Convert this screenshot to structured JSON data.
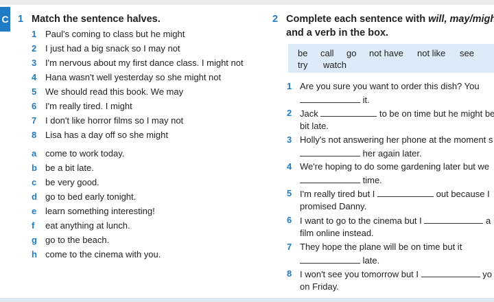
{
  "tab": {
    "label": "C"
  },
  "ex1": {
    "number": "1",
    "title": "Match the sentence halves.",
    "items": [
      {
        "num": "1",
        "text": "Paul's coming to class but he might"
      },
      {
        "num": "2",
        "text": "I just had a big snack so I may not"
      },
      {
        "num": "3",
        "text": "I'm nervous about my first dance class. I might not"
      },
      {
        "num": "4",
        "text": "Hana wasn't well yesterday so she might not"
      },
      {
        "num": "5",
        "text": "We should read this book. We may"
      },
      {
        "num": "6",
        "text": "I'm really tired. I might"
      },
      {
        "num": "7",
        "text": "I don't like horror films so I may not"
      },
      {
        "num": "8",
        "text": "Lisa has a day off so she might"
      }
    ],
    "endings": [
      {
        "letter": "a",
        "text": "come to work today."
      },
      {
        "letter": "b",
        "text": "be a bit late."
      },
      {
        "letter": "c",
        "text": "be very good."
      },
      {
        "letter": "d",
        "text": "go to bed early tonight."
      },
      {
        "letter": "e",
        "text": "learn something interesting!"
      },
      {
        "letter": "f",
        "text": "eat anything at lunch."
      },
      {
        "letter": "g",
        "text": "go to the beach."
      },
      {
        "letter": "h",
        "text": "come to the cinema with you."
      }
    ]
  },
  "ex2": {
    "number": "2",
    "title_pre": "Complete each sentence with ",
    "title_italic": "will, may/might",
    "title_line2": "and a verb in the box.",
    "words": [
      "be",
      "call",
      "go",
      "not have",
      "not like",
      "see",
      "try",
      "watch"
    ],
    "items": [
      {
        "num": "1",
        "l1": "Are you sure you want to order this dish? You",
        "l2_post": " it."
      },
      {
        "num": "2",
        "l1_pre": "Jack ",
        "l1_post": " to be on time but he might be",
        "l2": "bit late."
      },
      {
        "num": "3",
        "l1": "Holly's not answering her phone at the moment s",
        "l2_post": " her again later."
      },
      {
        "num": "4",
        "l1": "We're hoping to do some gardening later but we",
        "l2_post": " time."
      },
      {
        "num": "5",
        "l1_pre": "I'm really tired but I ",
        "l1_post": " out because I",
        "l2": "promised Danny."
      },
      {
        "num": "6",
        "l1_pre": "I want to go to the cinema but I ",
        "l1_post": " a",
        "l2": "film online instead."
      },
      {
        "num": "7",
        "l1": "They hope the plane will be on time but it",
        "l2_post": " late."
      },
      {
        "num": "8",
        "l1_pre": "I won't see you tomorrow but I ",
        "l1_post": " yo",
        "l2": "on Friday."
      }
    ]
  }
}
